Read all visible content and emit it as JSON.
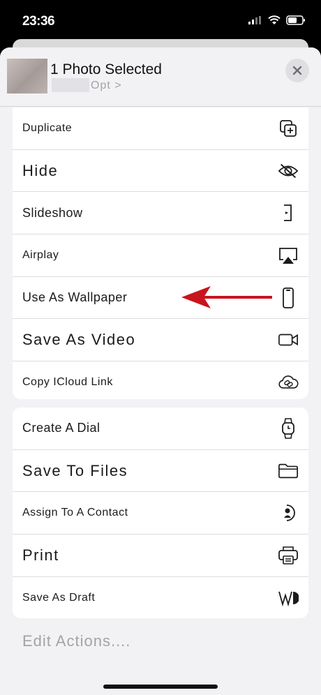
{
  "status": {
    "time": "23:36"
  },
  "header": {
    "title": "1 Photo Selected",
    "subtitle": "Opt >",
    "close_icon": "close-icon"
  },
  "actions_group1": [
    {
      "label": "Duplicate",
      "icon": "duplicate-icon"
    },
    {
      "label": "Hide",
      "icon": "eye-slash-icon"
    },
    {
      "label": "Slideshow",
      "icon": "slideshow-icon"
    },
    {
      "label": "Airplay",
      "icon": "airplay-icon"
    },
    {
      "label": "Use As Wallpaper",
      "icon": "phone-icon"
    },
    {
      "label": "Save As Video",
      "icon": "video-camera-icon"
    },
    {
      "label": "Copy ICloud Link",
      "icon": "cloud-link-icon"
    }
  ],
  "actions_group2": [
    {
      "label": "Create A Dial",
      "icon": "watch-icon"
    },
    {
      "label": "Save To Files",
      "icon": "folder-icon"
    },
    {
      "label": "Assign To A Contact",
      "icon": "contact-icon"
    },
    {
      "label": "Print",
      "icon": "printer-icon"
    },
    {
      "label": "Save As Draft",
      "icon": "draft-icon"
    }
  ],
  "footer": {
    "edit_actions": "Edit Actions...."
  },
  "colors": {
    "annotation_arrow": "#c8141e",
    "sheet_bg": "#f2f2f4"
  }
}
